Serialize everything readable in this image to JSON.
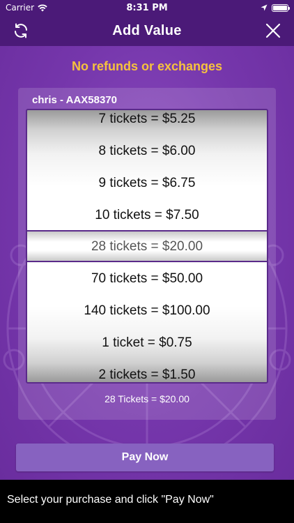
{
  "status_bar": {
    "carrier": "Carrier",
    "time": "8:31 PM",
    "icons": [
      "wifi-icon",
      "location-icon",
      "battery-icon"
    ]
  },
  "nav": {
    "title": "Add Value",
    "left_icon": "refresh-icon",
    "right_icon": "close-icon"
  },
  "notice": "No refunds or exchanges",
  "card": {
    "header": "chris - AAX58370",
    "picker": {
      "options": [
        "7 tickets = $5.25",
        "8 tickets = $6.00",
        "9 tickets = $6.75",
        "10 tickets = $7.50",
        "28 tickets = $20.00",
        "70 tickets = $50.00",
        "140 tickets = $100.00",
        "1 ticket = $0.75",
        "2 tickets = $1.50"
      ],
      "selected_index": 4
    },
    "summary": "28 Tickets = $20.00"
  },
  "pay_button": "Pay Now",
  "footer": "Select your purchase and click \"Pay Now\"",
  "colors": {
    "header_bg": "#4b1a78",
    "main_bg": "#7536ab",
    "accent_yellow": "#f6c23e",
    "button_bg": "#8762c0"
  }
}
